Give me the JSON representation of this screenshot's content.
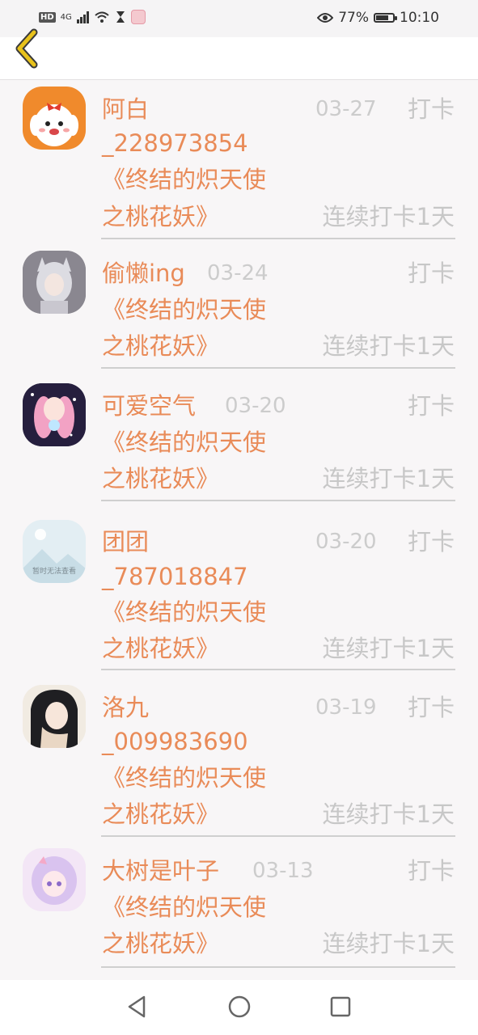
{
  "status_bar": {
    "left_badges": [
      "HD",
      "4G"
    ],
    "battery": "77%",
    "battery_level": 0.77,
    "time": "10:10"
  },
  "header": {
    "back_icon": "chevron-left-icon",
    "accent": "#e8b416"
  },
  "entries": [
    {
      "name_line1": "阿白",
      "name_line2": "_228973854",
      "date": "03-27",
      "tag": "打卡",
      "book_line1": "《终结的炽天使",
      "book_line2": "之桃花妖》",
      "streak": "连续打卡1天"
    },
    {
      "name_line1": "偷懒ing",
      "name_line2": "",
      "date": "03-24",
      "tag": "打卡",
      "book_line1": "《终结的炽天使",
      "book_line2": "之桃花妖》",
      "streak": "连续打卡1天"
    },
    {
      "name_line1": "可爱空气",
      "name_line2": "",
      "date": "03-20",
      "tag": "打卡",
      "book_line1": "《终结的炽天使",
      "book_line2": "之桃花妖》",
      "streak": "连续打卡1天"
    },
    {
      "name_line1": "团团",
      "name_line2": "_787018847",
      "date": "03-20",
      "tag": "打卡",
      "book_line1": "《终结的炽天使",
      "book_line2": "之桃花妖》",
      "streak": "连续打卡1天",
      "avatar_placeholder_text": "暂时无法查看"
    },
    {
      "name_line1": "洛九",
      "name_line2": "_009983690",
      "date": "03-19",
      "tag": "打卡",
      "book_line1": "《终结的炽天使",
      "book_line2": "之桃花妖》",
      "streak": "连续打卡1天"
    },
    {
      "name_line1": "大树是叶子",
      "name_line2": "",
      "date": "03-13",
      "tag": "打卡",
      "book_line1": "《终结的炽天使",
      "book_line2": "之桃花妖》",
      "streak": "连续打卡1天"
    }
  ],
  "colors": {
    "name": "#e98b58",
    "muted": "#c7c7c7",
    "divider": "#cfcfcf",
    "background": "#f8f6f7"
  },
  "nav_bar": {
    "icons": [
      "back-triangle-icon",
      "home-circle-icon",
      "recents-square-icon"
    ]
  }
}
